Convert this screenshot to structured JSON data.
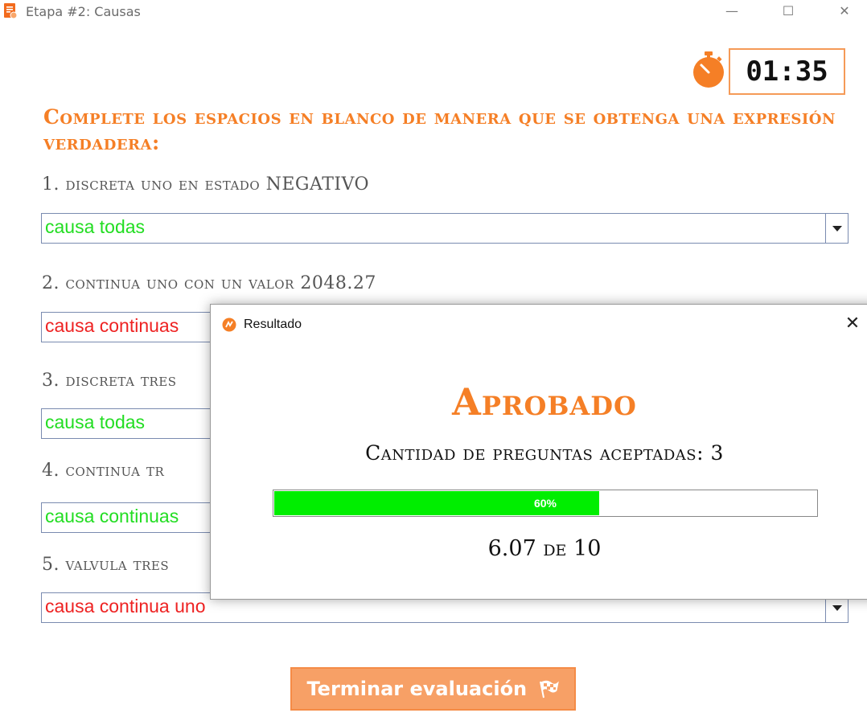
{
  "window": {
    "title": "Etapa #2: Causas",
    "minimize_glyph": "—",
    "maximize_glyph": "☐",
    "close_glyph": "✕"
  },
  "timer": {
    "value": "01:35",
    "icon": "stopwatch-icon"
  },
  "instructions": "Complete los espacios en blanco de manera que se obtenga una expresión verdadera:",
  "questions": [
    {
      "label": "1. discreta uno en estado NEGATIVO",
      "answer": "causa todas",
      "status": "correct"
    },
    {
      "label": "2. continua uno con un valor 2048.27",
      "answer": "causa continuas",
      "status": "incorrect"
    },
    {
      "label": "3. discreta tres",
      "answer": "causa todas",
      "status": "correct"
    },
    {
      "label": "4. continua tr",
      "answer": "causa continuas",
      "status": "correct"
    },
    {
      "label": "5. valvula tres",
      "answer": "causa continua uno",
      "status": "incorrect"
    }
  ],
  "finish_button": {
    "label": "Terminar evaluación",
    "icon": "checkered-flag-icon"
  },
  "dialog": {
    "title": "Resultado",
    "close_glyph": "✕",
    "result": "Aprobado",
    "accepted_text": "Cantidad de preguntas aceptadas: 3",
    "progress_percent": 60,
    "progress_label": "60%",
    "score_text": "6.07 de 10"
  },
  "colors": {
    "accent": "#f57f26",
    "correct": "#22dd22",
    "incorrect": "#ee2222",
    "progress": "#00ee00"
  }
}
